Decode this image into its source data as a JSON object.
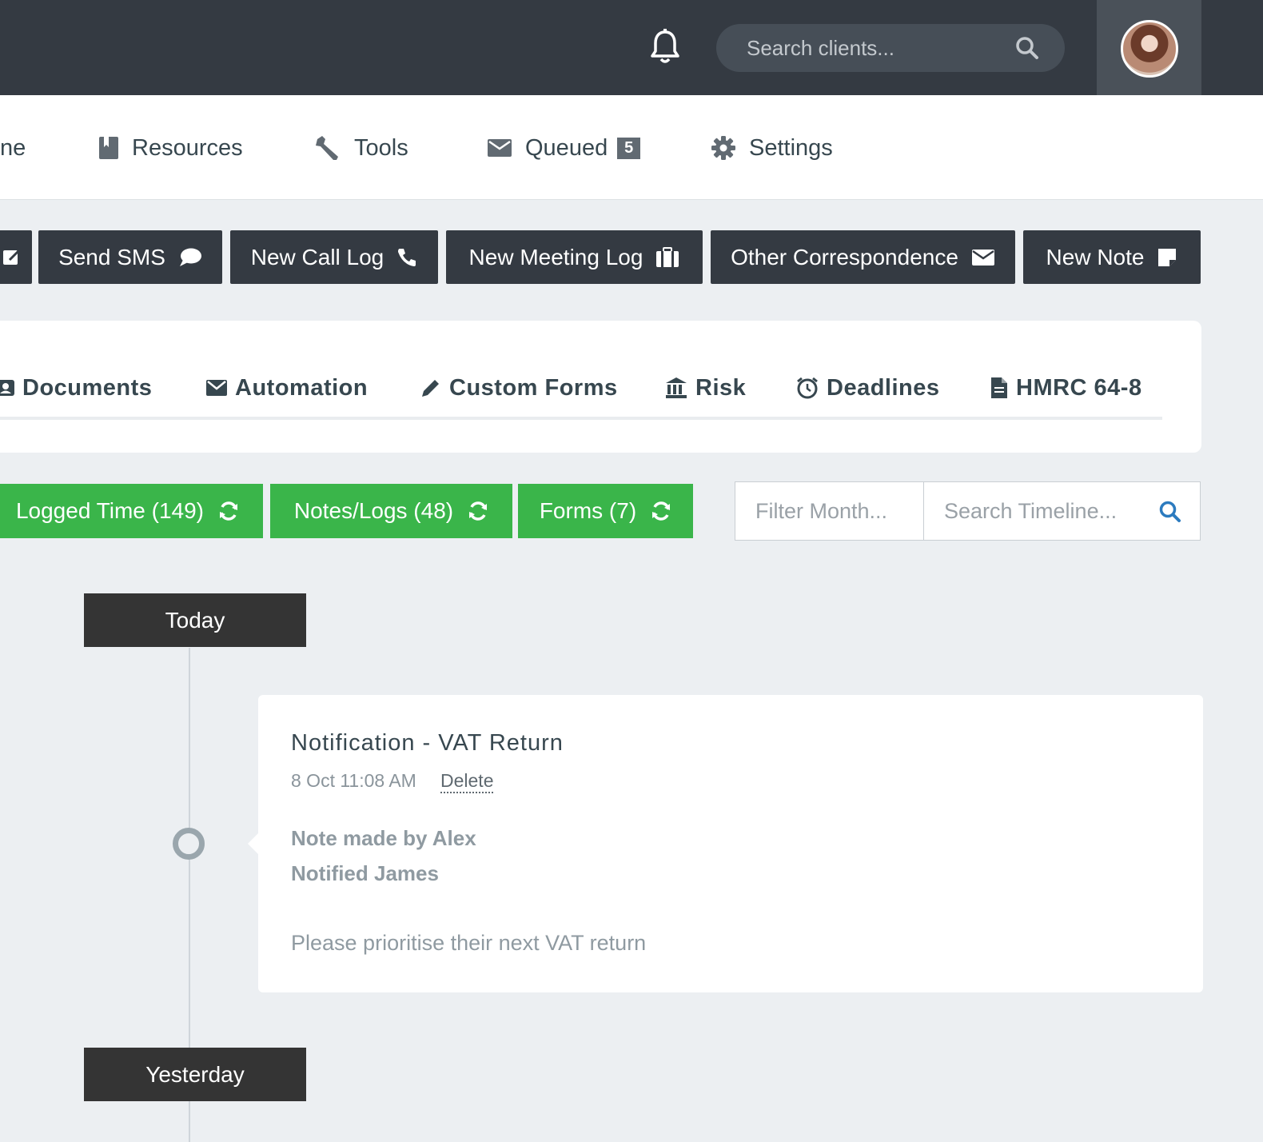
{
  "header": {
    "search_placeholder": "Search clients..."
  },
  "nav": {
    "items": [
      {
        "label": "ne"
      },
      {
        "label": "Resources"
      },
      {
        "label": "Tools"
      },
      {
        "label": "Queued",
        "badge": "5"
      },
      {
        "label": "Settings"
      }
    ]
  },
  "actions": [
    {
      "label": "Send SMS"
    },
    {
      "label": "New Call Log"
    },
    {
      "label": "New Meeting Log"
    },
    {
      "label": "Other Correspondence"
    },
    {
      "label": "New Note"
    }
  ],
  "tabs": [
    {
      "label": "Documents"
    },
    {
      "label": "Automation"
    },
    {
      "label": "Custom Forms"
    },
    {
      "label": "Risk"
    },
    {
      "label": "Deadlines"
    },
    {
      "label": "HMRC 64-8"
    }
  ],
  "filters": [
    {
      "label": "Logged Time (149)"
    },
    {
      "label": "Notes/Logs (48)"
    },
    {
      "label": "Forms (7)"
    }
  ],
  "filter_inputs": {
    "month_placeholder": "Filter Month...",
    "search_placeholder": "Search Timeline..."
  },
  "timeline": {
    "groups": [
      {
        "label": "Today"
      },
      {
        "label": "Yesterday"
      }
    ],
    "entry": {
      "title": "Notification - VAT Return",
      "time": "8 Oct 11:08 AM",
      "delete_label": "Delete",
      "line1": "Note made by Alex",
      "line2": "Notified James",
      "body": "Please prioritise their next VAT return"
    }
  },
  "colors": {
    "topbar": "#343a42",
    "action_button": "#343a42",
    "filter_green": "#3ab54a",
    "accent_blue": "#2c7bbf"
  }
}
